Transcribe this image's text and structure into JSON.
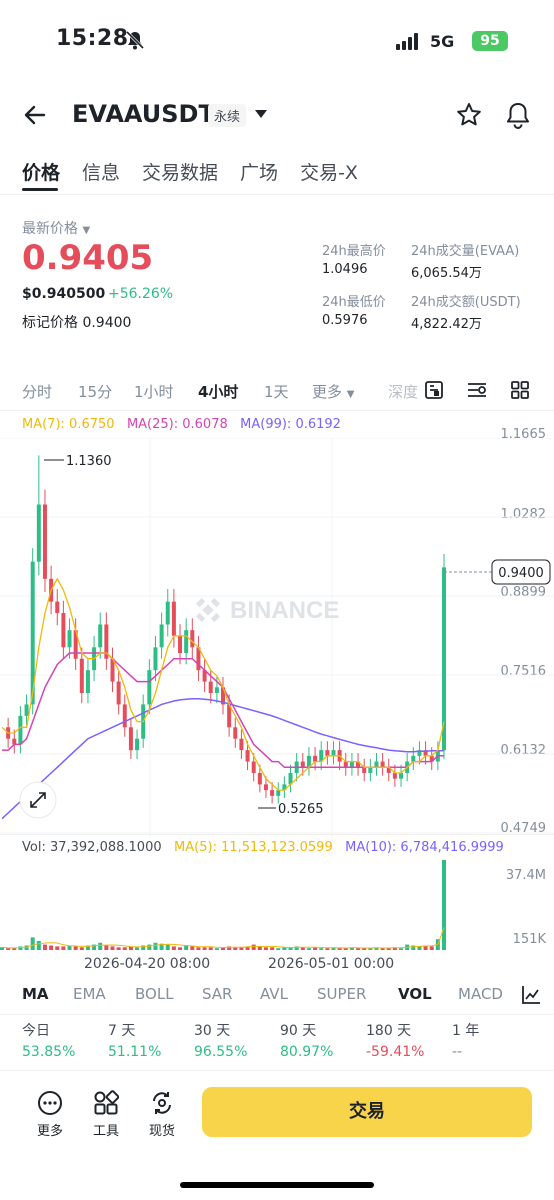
{
  "status": {
    "time": "15:28",
    "network": "5G",
    "battery": "95"
  },
  "header": {
    "symbol": "EVAAUSDT",
    "contract_type": "永续"
  },
  "tabs": [
    "价格",
    "信息",
    "交易数据",
    "广场",
    "交易-X"
  ],
  "price": {
    "label": "最新价格",
    "last": "0.9405",
    "usd": "$0.940500",
    "change": "+56.26%",
    "mark_label": "标记价格",
    "mark_value": "0.9400"
  },
  "stats": {
    "high_label": "24h最高价",
    "high": "1.0496",
    "low_label": "24h最低价",
    "low": "0.5976",
    "vol_label": "24h成交量(EVAA)",
    "vol": "6,065.54万",
    "turnover_label": "24h成交额(USDT)",
    "turnover": "4,822.42万"
  },
  "intervals": {
    "items": [
      "分时",
      "15分",
      "1小时",
      "4小时",
      "1天",
      "更多",
      "深度"
    ],
    "active": "4小时"
  },
  "ma": {
    "ma7": "MA(7): 0.6750",
    "ma25": "MA(25): 0.6078",
    "ma99": "MA(99): 0.6192"
  },
  "colors": {
    "up": "#2ebd85",
    "down": "#e54d5b",
    "ma7": "#f0b90b",
    "ma25": "#d445b3",
    "ma99": "#7b61ff",
    "accent": "#f7d44a"
  },
  "chart_data": {
    "type": "candlestick",
    "price_axis": [
      "1.1665",
      "1.0282",
      "0.8899",
      "0.7516",
      "0.6132",
      "0.4749"
    ],
    "ylim": [
      0.4749,
      1.1665
    ],
    "current_price_tag": "0.9400",
    "high_marker": "1.1360",
    "low_marker": "0.5265",
    "watermark": "BINANCE",
    "x_labels": [
      "2026-04-20 08:00",
      "2026-05-01 00:00"
    ],
    "volume_axis": [
      "37.4M",
      "151K"
    ],
    "series": [
      {
        "name": "price",
        "values": [
          0.66,
          0.64,
          0.63,
          0.68,
          0.7,
          0.95,
          1.05,
          0.92,
          0.88,
          0.86,
          0.8,
          0.83,
          0.78,
          0.72,
          0.76,
          0.8,
          0.84,
          0.78,
          0.74,
          0.7,
          0.66,
          0.62,
          0.64,
          0.7,
          0.76,
          0.8,
          0.84,
          0.88,
          0.82,
          0.79,
          0.83,
          0.8,
          0.76,
          0.74,
          0.72,
          0.73,
          0.7,
          0.66,
          0.64,
          0.62,
          0.6,
          0.58,
          0.56,
          0.55,
          0.54,
          0.55,
          0.56,
          0.58,
          0.6,
          0.59,
          0.61,
          0.6,
          0.62,
          0.61,
          0.62,
          0.6,
          0.59,
          0.6,
          0.59,
          0.58,
          0.59,
          0.6,
          0.59,
          0.58,
          0.57,
          0.58,
          0.6,
          0.61,
          0.62,
          0.61,
          0.6,
          0.62,
          0.94
        ]
      },
      {
        "name": "MA(7)",
        "values": [
          0.66,
          0.65,
          0.65,
          0.66,
          0.66,
          0.72,
          0.8,
          0.86,
          0.9,
          0.92,
          0.9,
          0.87,
          0.83,
          0.79,
          0.78,
          0.78,
          0.79,
          0.79,
          0.78,
          0.76,
          0.73,
          0.69,
          0.67,
          0.67,
          0.69,
          0.72,
          0.76,
          0.8,
          0.82,
          0.82,
          0.82,
          0.81,
          0.8,
          0.78,
          0.76,
          0.75,
          0.73,
          0.7,
          0.68,
          0.66,
          0.63,
          0.61,
          0.59,
          0.57,
          0.56,
          0.55,
          0.55,
          0.56,
          0.57,
          0.58,
          0.59,
          0.6,
          0.6,
          0.61,
          0.61,
          0.61,
          0.6,
          0.6,
          0.6,
          0.59,
          0.59,
          0.59,
          0.59,
          0.59,
          0.58,
          0.58,
          0.59,
          0.6,
          0.6,
          0.61,
          0.61,
          0.62,
          0.67
        ]
      },
      {
        "name": "MA(25)",
        "values": [
          0.62,
          0.62,
          0.63,
          0.63,
          0.64,
          0.67,
          0.7,
          0.73,
          0.75,
          0.77,
          0.78,
          0.79,
          0.79,
          0.79,
          0.79,
          0.79,
          0.79,
          0.79,
          0.78,
          0.77,
          0.76,
          0.75,
          0.74,
          0.74,
          0.74,
          0.75,
          0.76,
          0.77,
          0.78,
          0.78,
          0.78,
          0.78,
          0.77,
          0.76,
          0.75,
          0.74,
          0.73,
          0.71,
          0.69,
          0.67,
          0.65,
          0.63,
          0.62,
          0.61,
          0.6,
          0.6,
          0.59,
          0.59,
          0.59,
          0.59,
          0.59,
          0.59,
          0.59,
          0.59,
          0.59,
          0.59,
          0.59,
          0.59,
          0.59,
          0.59,
          0.59,
          0.59,
          0.59,
          0.59,
          0.59,
          0.59,
          0.59,
          0.6,
          0.6,
          0.6,
          0.6,
          0.61,
          0.61
        ]
      },
      {
        "name": "MA(99)",
        "values": [
          0.5,
          0.51,
          0.52,
          0.53,
          0.54,
          0.55,
          0.56,
          0.57,
          0.58,
          0.59,
          0.6,
          0.61,
          0.62,
          0.63,
          0.64,
          0.645,
          0.65,
          0.655,
          0.66,
          0.665,
          0.67,
          0.675,
          0.68,
          0.685,
          0.69,
          0.695,
          0.7,
          0.703,
          0.706,
          0.708,
          0.709,
          0.71,
          0.71,
          0.709,
          0.708,
          0.706,
          0.704,
          0.701,
          0.698,
          0.695,
          0.692,
          0.689,
          0.686,
          0.683,
          0.68,
          0.676,
          0.672,
          0.668,
          0.664,
          0.66,
          0.656,
          0.652,
          0.648,
          0.645,
          0.642,
          0.639,
          0.636,
          0.633,
          0.63,
          0.628,
          0.626,
          0.624,
          0.622,
          0.62,
          0.619,
          0.618,
          0.617,
          0.617,
          0.618,
          0.618,
          0.619,
          0.619,
          0.6192
        ]
      }
    ]
  },
  "volume": {
    "vol": "Vol: 37,392,088.1000",
    "ma5": "MA(5): 11,513,123.0599",
    "ma10": "MA(10): 6,784,416.9999",
    "bars": [
      0.03,
      0.02,
      0.02,
      0.04,
      0.05,
      0.14,
      0.1,
      0.06,
      0.05,
      0.04,
      0.04,
      0.05,
      0.04,
      0.03,
      0.05,
      0.06,
      0.08,
      0.05,
      0.04,
      0.03,
      0.03,
      0.04,
      0.03,
      0.05,
      0.06,
      0.08,
      0.07,
      0.06,
      0.04,
      0.03,
      0.05,
      0.04,
      0.03,
      0.03,
      0.03,
      0.02,
      0.03,
      0.04,
      0.03,
      0.03,
      0.04,
      0.06,
      0.04,
      0.03,
      0.03,
      0.02,
      0.03,
      0.03,
      0.04,
      0.03,
      0.02,
      0.03,
      0.02,
      0.02,
      0.03,
      0.02,
      0.02,
      0.03,
      0.02,
      0.02,
      0.02,
      0.03,
      0.02,
      0.02,
      0.03,
      0.02,
      0.06,
      0.05,
      0.04,
      0.05,
      0.04,
      0.12,
      1.0
    ]
  },
  "indicators": {
    "items": [
      "MA",
      "EMA",
      "BOLL",
      "SAR",
      "AVL",
      "SUPER",
      "VOL",
      "MACD"
    ],
    "active_main": "MA",
    "active_sub": "VOL"
  },
  "performance": [
    {
      "label": "今日",
      "value": "53.85%",
      "dir": "up"
    },
    {
      "label": "7 天",
      "value": "51.11%",
      "dir": "up"
    },
    {
      "label": "30 天",
      "value": "96.55%",
      "dir": "up"
    },
    {
      "label": "90 天",
      "value": "80.97%",
      "dir": "up"
    },
    {
      "label": "180 天",
      "value": "-59.41%",
      "dir": "down"
    },
    {
      "label": "1 年",
      "value": "--",
      "dir": "none"
    }
  ],
  "bottom": {
    "more": "更多",
    "tools": "工具",
    "spot": "现货",
    "trade": "交易"
  }
}
